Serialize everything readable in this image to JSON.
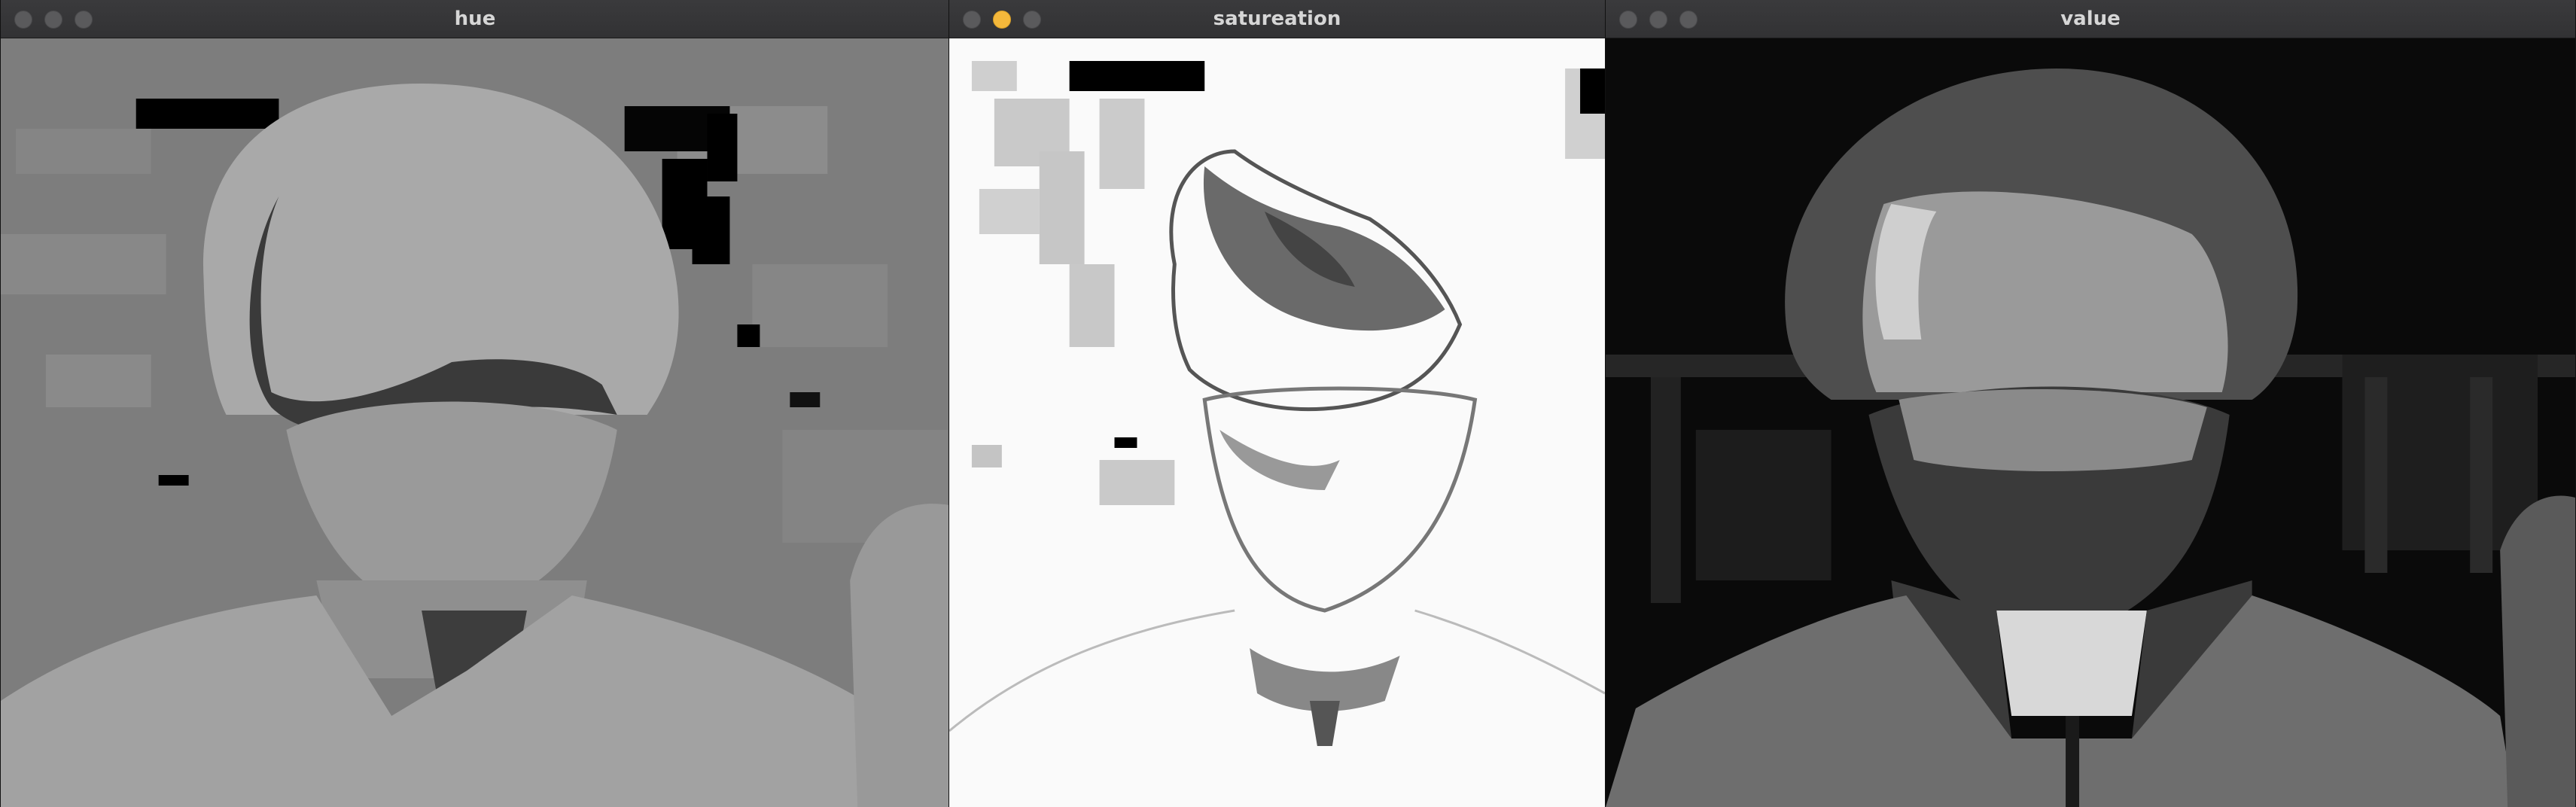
{
  "windows": [
    {
      "id": "hue",
      "title": "hue"
    },
    {
      "id": "sat",
      "title": "satureation"
    },
    {
      "id": "val",
      "title": "value"
    }
  ],
  "colors": {
    "titlebar": "#343436",
    "title_text": "#d6d6d6",
    "traffic_inactive": "#5a5a5c",
    "traffic_minimize": "#f4b83b"
  },
  "icons": [
    "close-icon",
    "minimize-icon",
    "zoom-icon"
  ]
}
